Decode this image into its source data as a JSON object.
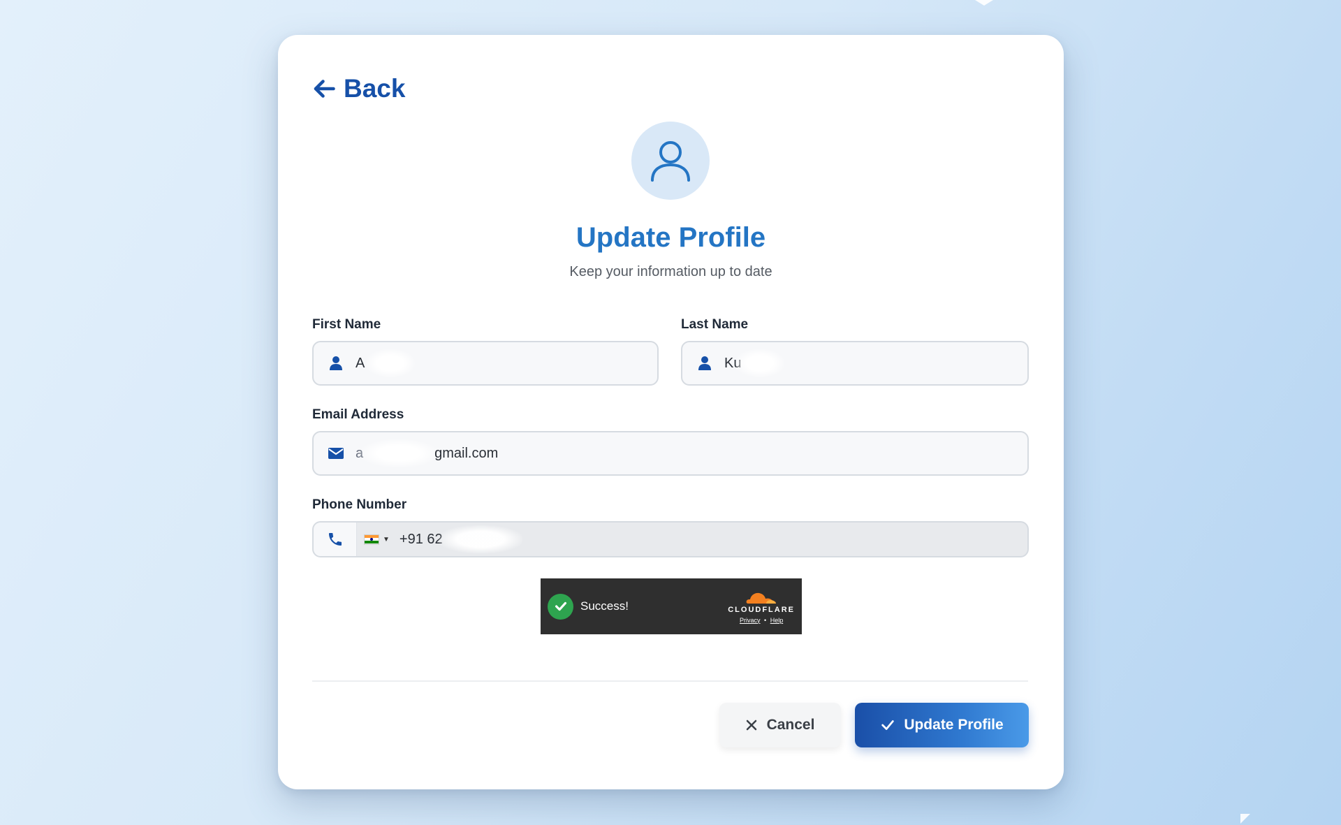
{
  "nav": {
    "back_label": "Back"
  },
  "header": {
    "title": "Update Profile",
    "subtitle": "Keep your information up to date"
  },
  "form": {
    "first_name": {
      "label": "First Name",
      "value": "A"
    },
    "last_name": {
      "label": "Last Name",
      "value": "Ku"
    },
    "email": {
      "label": "Email Address",
      "value_prefix": "a",
      "value_suffix": "gmail.com"
    },
    "phone": {
      "label": "Phone Number",
      "country": "India",
      "value": "+91 62"
    }
  },
  "captcha": {
    "status": "Success!",
    "brand": "CLOUDFLARE",
    "privacy": "Privacy",
    "separator": "•",
    "help": "Help"
  },
  "actions": {
    "cancel_label": "Cancel",
    "submit_label": "Update Profile"
  },
  "colors": {
    "accent": "#1650a8",
    "title": "#2475c4",
    "success": "#2ea44f"
  }
}
